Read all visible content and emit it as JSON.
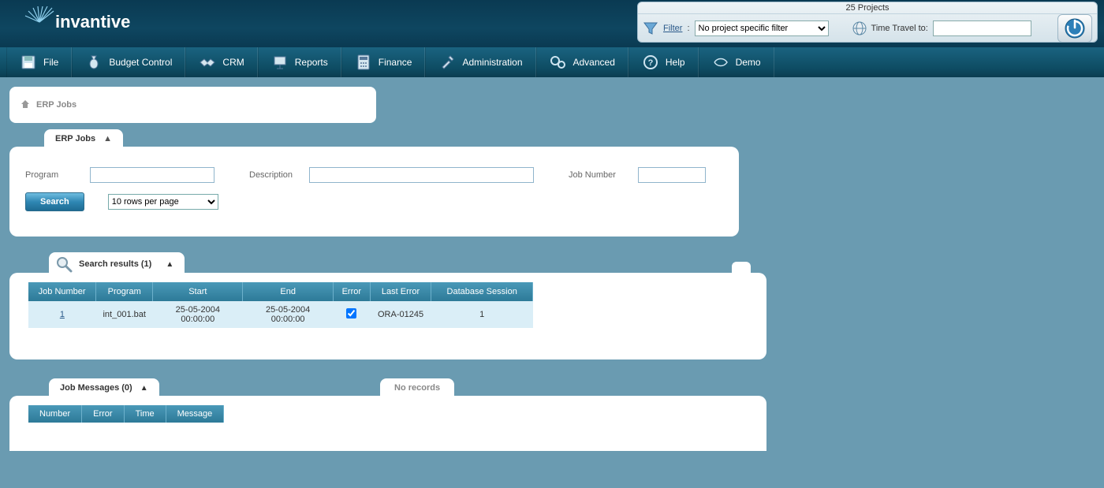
{
  "header": {
    "brand": "invantive",
    "projects_title": "25 Projects",
    "filter_label": "Filter",
    "filter_selected": "No project specific filter",
    "time_travel_label": "Time Travel to:",
    "time_travel_value": ""
  },
  "menu": [
    {
      "label": "File"
    },
    {
      "label": "Budget Control"
    },
    {
      "label": "CRM"
    },
    {
      "label": "Reports"
    },
    {
      "label": "Finance"
    },
    {
      "label": "Administration"
    },
    {
      "label": "Advanced"
    },
    {
      "label": "Help"
    },
    {
      "label": "Demo"
    }
  ],
  "breadcrumb": {
    "title": "ERP Jobs"
  },
  "search_panel": {
    "tab": "ERP Jobs",
    "program_label": "Program",
    "description_label": "Description",
    "jobnumber_label": "Job Number",
    "search_btn": "Search",
    "rows_per_page": "10 rows per page"
  },
  "results": {
    "tab": "Search results (1)",
    "columns": [
      "Job Number",
      "Program",
      "Start",
      "End",
      "Error",
      "Last Error",
      "Database Session"
    ],
    "row": {
      "job_number": "1",
      "program": "int_001.bat",
      "start": "25-05-2004 00:00:00",
      "end": "25-05-2004 00:00:00",
      "error": true,
      "last_error": "ORA-01245",
      "db_session": "1"
    }
  },
  "messages": {
    "tab": "Job Messages (0)",
    "no_records": "No records",
    "columns": [
      "Number",
      "Error",
      "Time",
      "Message"
    ]
  }
}
